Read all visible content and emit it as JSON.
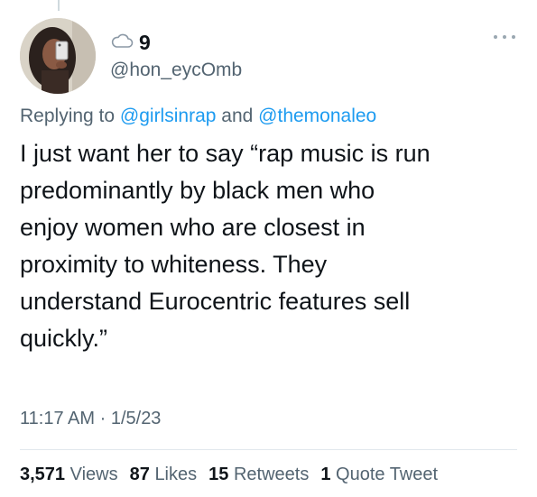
{
  "user": {
    "display_name": "9",
    "handle": "@hon_eycOmb",
    "name_icon": "cloud-icon"
  },
  "reply": {
    "prefix": "Replying to",
    "mention_1": "@girlsinrap",
    "conjunction": "and",
    "mention_2": "@themonaleo"
  },
  "tweet": {
    "text": "I just want her to say “rap music is run\npredominantly by black men who\nenjoy women who are closest in\nproximity to whiteness. They\nunderstand Eurocentric features sell\nquickly.”"
  },
  "meta": {
    "time": "11:17 AM",
    "separator": "·",
    "date": "1/5/23"
  },
  "stats": {
    "views_count": "3,571",
    "views_label": "Views",
    "likes_count": "87",
    "likes_label": "Likes",
    "retweets_count": "15",
    "retweets_label": "Retweets",
    "quotes_count": "1",
    "quotes_label": "Quote Tweet"
  },
  "colors": {
    "link": "#1d9bf0",
    "secondary_text": "#536471",
    "primary_text": "#0f1419"
  }
}
